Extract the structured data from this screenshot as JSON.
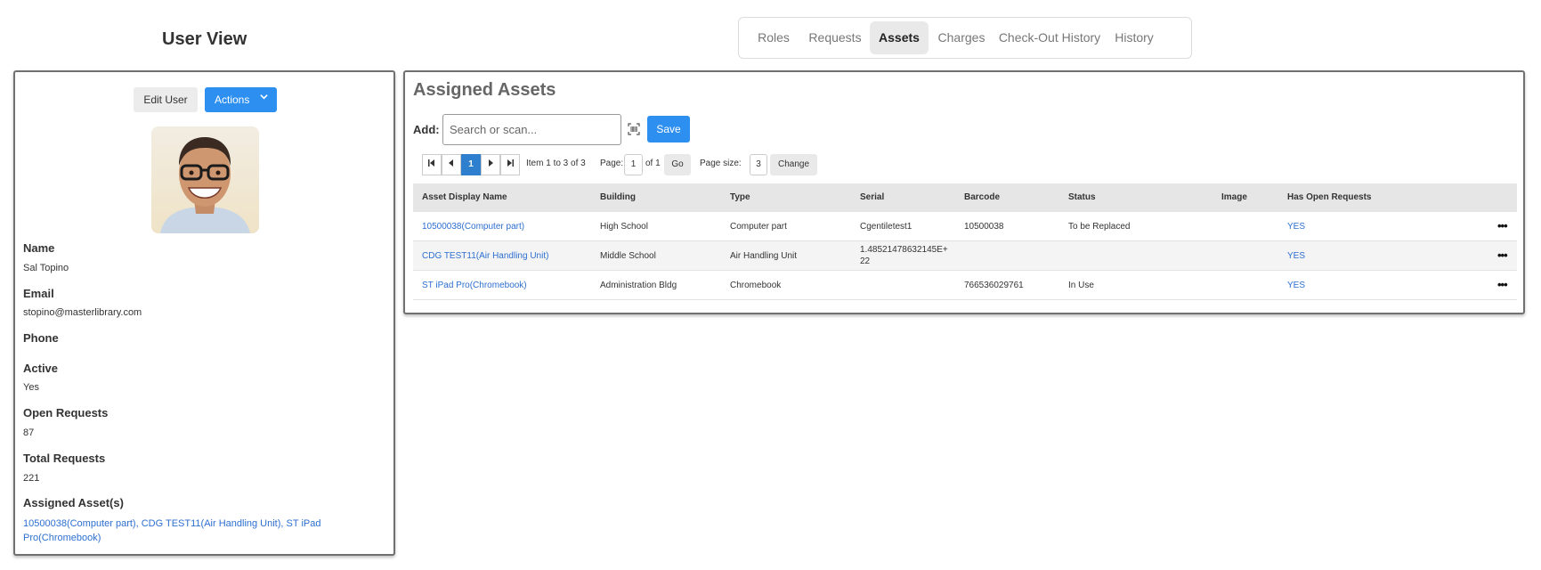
{
  "page_title": "User View",
  "tabs": [
    {
      "label": "Roles"
    },
    {
      "label": "Requests"
    },
    {
      "label": "Assets"
    },
    {
      "label": "Charges"
    },
    {
      "label": "Check-Out History"
    },
    {
      "label": "History"
    }
  ],
  "active_tab": "Assets",
  "user_card": {
    "edit_label": "Edit User",
    "actions_label": "Actions",
    "fields": {
      "name": {
        "label": "Name",
        "value": "Sal Topino"
      },
      "email": {
        "label": "Email",
        "value": "stopino@masterlibrary.com"
      },
      "phone": {
        "label": "Phone",
        "value": ""
      },
      "active": {
        "label": "Active",
        "value": "Yes"
      },
      "open_requests": {
        "label": "Open Requests",
        "value": "87"
      },
      "total_requests": {
        "label": "Total Requests",
        "value": "221"
      },
      "assigned_assets": {
        "label": "Assigned Asset(s)"
      }
    },
    "assigned_asset_links": [
      "10500038(Computer part)",
      "CDG TEST11(Air Handling Unit)",
      "ST iPad Pro(Chromebook)"
    ],
    "separator": ", "
  },
  "assets_panel": {
    "title": "Assigned Assets",
    "add_label": "Add:",
    "search_placeholder": "Search or scan...",
    "save_label": "Save",
    "pager": {
      "current_page": "1",
      "item_range": "Item 1 to 3 of 3",
      "page_label": "Page:",
      "page_value": "1",
      "of_label": "of 1",
      "go_label": "Go",
      "page_size_label": "Page size:",
      "page_size_value": "3",
      "change_label": "Change"
    },
    "columns": [
      "Asset Display Name",
      "Building",
      "Type",
      "Serial",
      "Barcode",
      "Status",
      "Image",
      "Has Open Requests"
    ],
    "rows": [
      {
        "name": "10500038(Computer part)",
        "building": "High School",
        "type": "Computer part",
        "serial": "Cgentiletest1",
        "barcode": "10500038",
        "status": "To be Replaced",
        "image": "",
        "open": "YES"
      },
      {
        "name": "CDG TEST11(Air Handling Unit)",
        "building": "Middle School",
        "type": "Air Handling Unit",
        "serial": "1.48521478632145E+22",
        "barcode": "",
        "status": "",
        "image": "",
        "open": "YES"
      },
      {
        "name": "ST iPad Pro(Chromebook)",
        "building": "Administration Bldg",
        "type": "Chromebook",
        "serial": "",
        "barcode": "766536029761",
        "status": "In Use",
        "image": "",
        "open": "YES"
      }
    ],
    "row_menu_glyph": "•••"
  },
  "colors": {
    "accent": "#2d8ff0",
    "link": "#2d6fd0",
    "active_page": "#2f7fcf"
  },
  "icons": [
    "first-page-icon",
    "prev-page-icon",
    "next-page-icon",
    "last-page-icon",
    "barcode-scan-icon",
    "chevron-down-icon",
    "more-options-icon"
  ]
}
